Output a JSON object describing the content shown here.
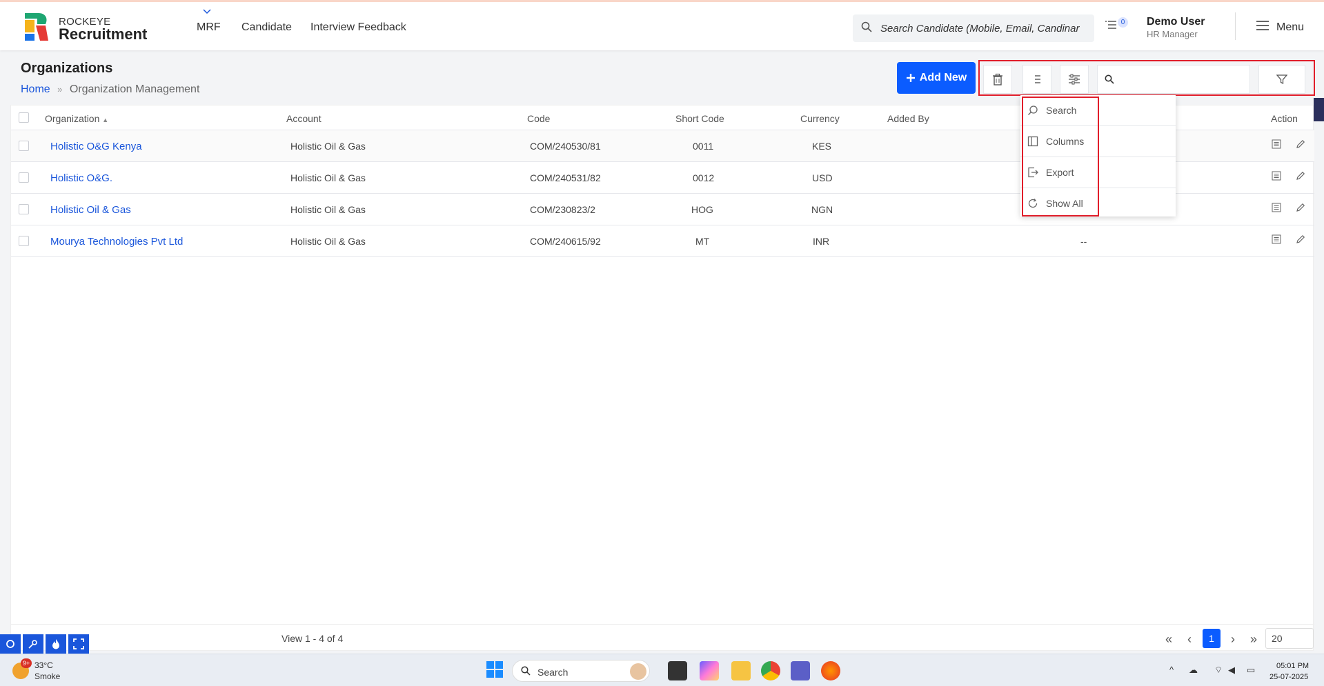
{
  "brand": {
    "top": "ROCKEYE",
    "main": "Recruitment"
  },
  "nav": {
    "items": [
      {
        "label": "MRF"
      },
      {
        "label": "Candidate"
      },
      {
        "label": "Interview Feedback"
      }
    ]
  },
  "search": {
    "value": "Search Candidate (Mobile, Email, Candinar"
  },
  "notifications": {
    "count": "0"
  },
  "user": {
    "name": "Demo User",
    "role": "HR Manager"
  },
  "menu": {
    "label": "Menu"
  },
  "page": {
    "title": "Organizations",
    "breadcrumb": {
      "home": "Home",
      "current": "Organization Management"
    },
    "add_label": "Add New"
  },
  "table": {
    "columns": [
      "Organization",
      "Account",
      "Code",
      "Short Code",
      "Currency",
      "Added By",
      "Action"
    ],
    "rows": [
      {
        "organization": "Holistic O&G Kenya",
        "account": "Holistic Oil & Gas",
        "code": "COM/240530/81",
        "short_code": "0011",
        "currency": "KES",
        "added_by": ""
      },
      {
        "organization": "Holistic O&G.",
        "account": "Holistic Oil & Gas",
        "code": "COM/240531/82",
        "short_code": "0012",
        "currency": "USD",
        "added_by": ""
      },
      {
        "organization": "Holistic Oil & Gas",
        "account": "Holistic Oil & Gas",
        "code": "COM/230823/2",
        "short_code": "HOG",
        "currency": "NGN",
        "added_by": ""
      },
      {
        "organization": "Mourya Technologies Pvt Ltd",
        "account": "Holistic Oil & Gas",
        "code": "COM/240615/92",
        "short_code": "MT",
        "currency": "INR",
        "added_by": "--"
      }
    ]
  },
  "dropdown": {
    "items": [
      {
        "label": "Search",
        "icon": "search-icon"
      },
      {
        "label": "Columns",
        "icon": "columns-icon"
      },
      {
        "label": "Export",
        "icon": "export-icon"
      },
      {
        "label": "Show All",
        "icon": "refresh-icon"
      }
    ]
  },
  "pagination": {
    "view_text": "View 1 - 4 of 4",
    "current_page": "1",
    "page_size": "20"
  },
  "taskbar": {
    "weather_temp": "33°C",
    "weather_desc": "Smoke",
    "weather_badge": "9+",
    "search_label": "Search",
    "time": "05:01 PM",
    "date": "25-07-2025"
  },
  "colors": {
    "accent": "#0b5cff",
    "highlight": "#e11d2a",
    "link": "#1a56db"
  }
}
